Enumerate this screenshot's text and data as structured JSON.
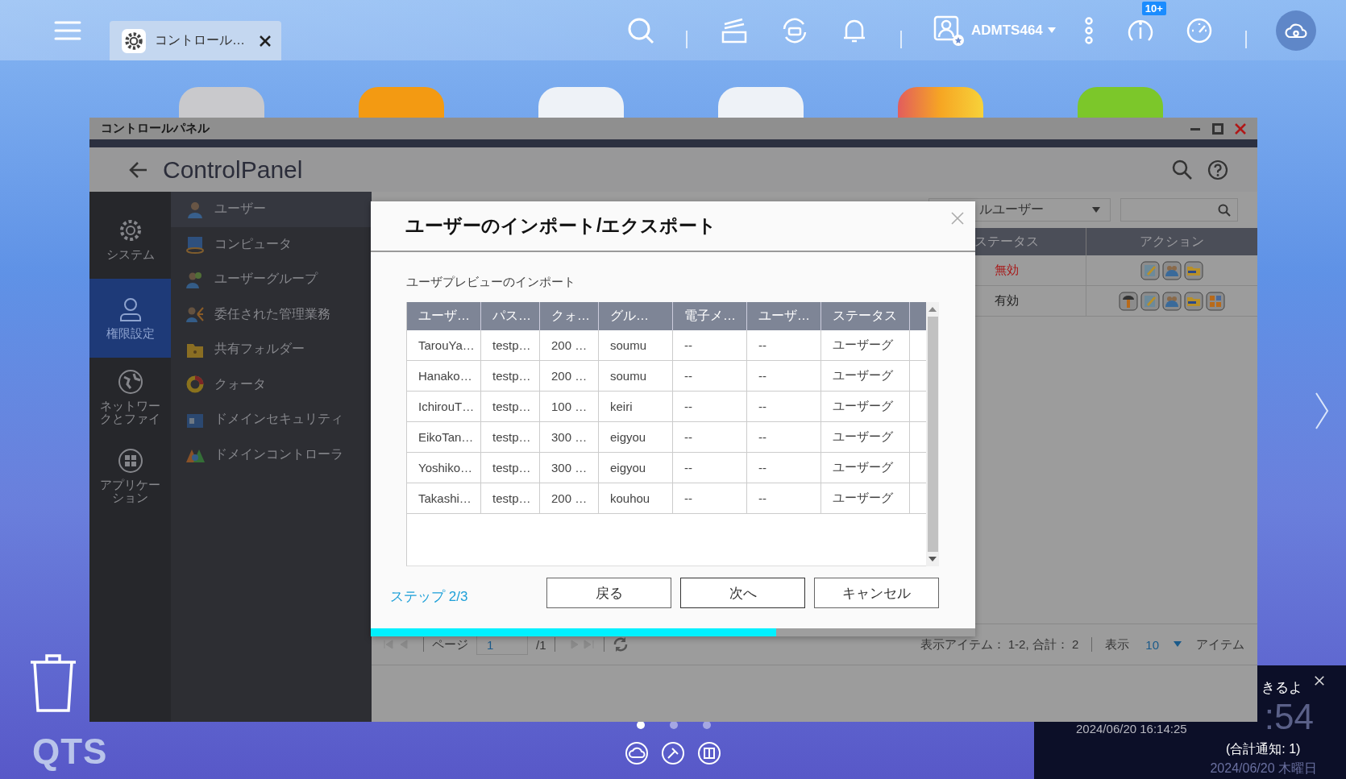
{
  "top_bar": {
    "tabs": [
      {
        "label": "コントロール…",
        "selected": true
      }
    ],
    "user": "ADMTS464",
    "badge": "10+"
  },
  "window": {
    "title": "コントロールパネル",
    "app_title": "ControlPanel",
    "nav": [
      {
        "label": "システム",
        "kind": "gear",
        "selected": false
      },
      {
        "label": "権限設定",
        "kind": "person",
        "selected": true
      },
      {
        "label": "ネットワークとファイ",
        "kind": "globe",
        "selected": false
      },
      {
        "label": "アプリケーション",
        "kind": "apps",
        "selected": false
      }
    ],
    "subnav": [
      {
        "label": "ユーザー",
        "kind": "user",
        "selected": true
      },
      {
        "label": "コンピュータ",
        "kind": "computer",
        "selected": false
      },
      {
        "label": "ユーザーグループ",
        "kind": "group",
        "selected": false
      },
      {
        "label": "委任された管理業務",
        "kind": "delegate",
        "selected": false
      },
      {
        "label": "共有フォルダー",
        "kind": "folder",
        "selected": false
      },
      {
        "label": "クォータ",
        "kind": "quota",
        "selected": false
      },
      {
        "label": "ドメインセキュリティ",
        "kind": "security",
        "selected": false
      },
      {
        "label": "ドメインコントローラ",
        "kind": "controller",
        "selected": false
      }
    ],
    "filter": "ルユーザー",
    "table": {
      "columns": [
        "ステータス",
        "アクション"
      ],
      "rows": [
        {
          "status": "無効",
          "active": false,
          "actions": [
            {
              "kind": "edit"
            },
            {
              "kind": "group"
            },
            {
              "kind": "folder"
            }
          ]
        },
        {
          "status": "有効",
          "active": true,
          "actions": [
            {
              "kind": "key"
            },
            {
              "kind": "edit"
            },
            {
              "kind": "group"
            },
            {
              "kind": "folder"
            },
            {
              "kind": "apps"
            }
          ]
        }
      ]
    },
    "pagination": {
      "page_label": "ページ",
      "page": "1",
      "total_pages": "/1",
      "summary": "表示アイテム： 1-2, 合計： 2",
      "show_label": "表示",
      "per_page": "10",
      "items_label": "アイテム"
    }
  },
  "dialog": {
    "title": "ユーザーのインポート/エクスポート",
    "section": "ユーザプレビューのインポート",
    "columns": [
      "ユーザ…",
      "パス…",
      "クォ…",
      "グル…",
      "電子メ…",
      "ユーザ…",
      "ステータス"
    ],
    "rows": [
      [
        "TarouYa…",
        "testp…",
        "200 …",
        "soumu",
        "--",
        "--",
        "ユーザーグ"
      ],
      [
        "Hanako…",
        "testp…",
        "200 …",
        "soumu",
        "--",
        "--",
        "ユーザーグ"
      ],
      [
        "IchirouT…",
        "testp…",
        "100 …",
        "keiri",
        "--",
        "--",
        "ユーザーグ"
      ],
      [
        "EikoTan…",
        "testp…",
        "300 …",
        "eigyou",
        "--",
        "--",
        "ユーザーグ"
      ],
      [
        "Yoshiko…",
        "testp…",
        "300 …",
        "eigyou",
        "--",
        "--",
        "ユーザーグ"
      ],
      [
        "Takashi…",
        "testp…",
        "200 …",
        "kouhou",
        "--",
        "--",
        "ユーザーグ"
      ]
    ],
    "step": "ステップ 2/3",
    "buttons": [
      "戻る",
      "次へ",
      "キャンセル"
    ],
    "progress": {
      "level": 0.67
    }
  },
  "notification": {
    "message": "きるよ",
    "time": "2024/06/20 16:14:25",
    "clock": ":54",
    "count": "(合計通知: 1)",
    "date": "2024/06/20 木曜日"
  },
  "page_dots": [
    {
      "selected": true
    },
    {
      "selected": false
    },
    {
      "selected": false
    }
  ],
  "logo": "QTS"
}
